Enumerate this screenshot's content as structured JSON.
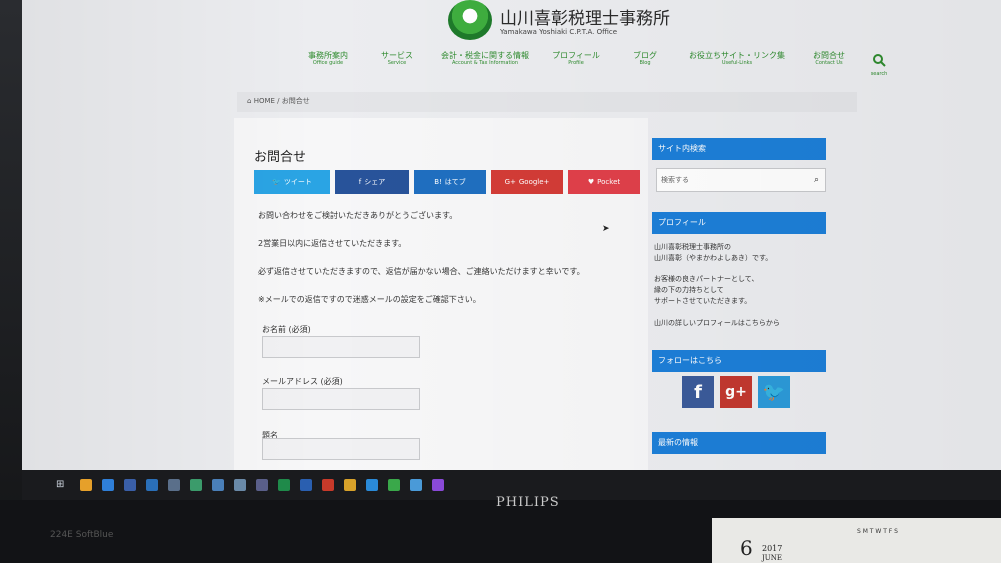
{
  "site": {
    "title": "山川喜彰税理士事務所",
    "subtitle": "Yamakawa Yoshiaki C.P.T.A. Office"
  },
  "nav": [
    {
      "jp": "事務所案内",
      "en": "Office guide"
    },
    {
      "jp": "サービス",
      "en": "Service"
    },
    {
      "jp": "会計・税金に関する情報",
      "en": "Account & Tax Information"
    },
    {
      "jp": "プロフィール",
      "en": "Profile"
    },
    {
      "jp": "ブログ",
      "en": "Blog"
    },
    {
      "jp": "お役立ちサイト・リンク集",
      "en": "Useful-Links"
    },
    {
      "jp": "お問合せ",
      "en": "Contact Us"
    }
  ],
  "nav_search_label": "search",
  "breadcrumb": {
    "home": "HOME",
    "sep": "/",
    "current": "お問合せ"
  },
  "main": {
    "page_title": "お問合せ",
    "share": {
      "tweet": "ツイート",
      "facebook": "シェア",
      "hatena": "はてブ",
      "google": "Google+",
      "pocket": "Pocket"
    },
    "paragraphs": [
      "お問い合わせをご検討いただきありがとうございます。",
      "2営業日以内に返信させていただきます。",
      "必ず返信させていただきますので、返信が届かない場合、ご連絡いただけますと幸いです。",
      "※メールでの返信ですので迷惑メールの設定をご確認下さい。"
    ],
    "form": {
      "name_label": "お名前 (必須)",
      "email_label": "メールアドレス (必須)",
      "subject_label": "題名"
    }
  },
  "sidebar": {
    "search_title": "サイト内検索",
    "search_placeholder": "検索する",
    "profile_title": "プロフィール",
    "profile_lines": [
      "山川喜彰税理士事務所の",
      "山川喜彰（やまかわよしあき）です。",
      "お客様の良きパートナーとして、",
      "縁の下の力持ちとして",
      "サポートさせていただきます。",
      "山川の詳しいプロフィールはこちらから"
    ],
    "follow_title": "フォローはこちら",
    "recent_title": "最新の情報"
  },
  "monitor": {
    "brand": "PHILIPS",
    "model": "224E SoftBlue"
  },
  "calendar": {
    "day": "6",
    "year": "2017",
    "month": "JUNE",
    "days_row": "S M T W T F S"
  },
  "colors": {
    "accent": "#1d7fd8",
    "nav_green": "#2e8b2e",
    "twitter": "#2aa4e4",
    "facebook": "#28539a",
    "hatena": "#1f6fc0",
    "google": "#d33c37",
    "pocket": "#e0404a"
  }
}
